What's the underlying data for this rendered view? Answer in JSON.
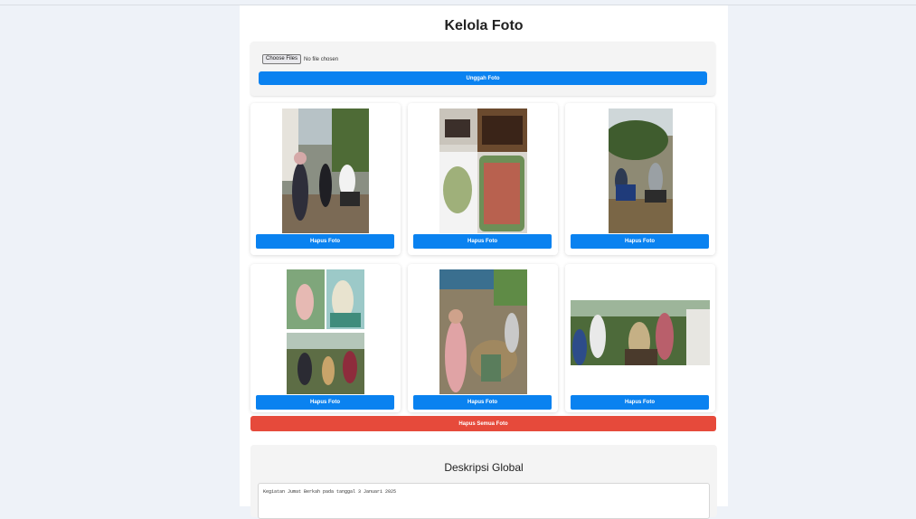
{
  "page": {
    "title": "Kelola Foto"
  },
  "upload": {
    "choose_label": "Choose Files",
    "no_file_label": "No file chosen",
    "upload_label": "Unggah Foto"
  },
  "photos": {
    "delete_label": "Hapus Foto",
    "items": [
      {
        "subject": "street gathering with motorcycle",
        "orientation": "portrait"
      },
      {
        "subject": "food packages and snacks",
        "orientation": "portrait"
      },
      {
        "subject": "people with motorcycles outdoors",
        "orientation": "portrait"
      },
      {
        "subject": "collage of distribution activity",
        "orientation": "portrait"
      },
      {
        "subject": "crowd at market tables",
        "orientation": "portrait"
      },
      {
        "subject": "people handing items near house",
        "orientation": "landscape"
      }
    ]
  },
  "delete_all_label": "Hapus Semua Foto",
  "description": {
    "title": "Deskripsi Global",
    "text": "Kegiatan Jumat Berkah pada tanggal 3 Januari 2025"
  },
  "colors": {
    "primary": "#0a82f0",
    "danger": "#e64a3b",
    "background": "#eef2f8"
  }
}
